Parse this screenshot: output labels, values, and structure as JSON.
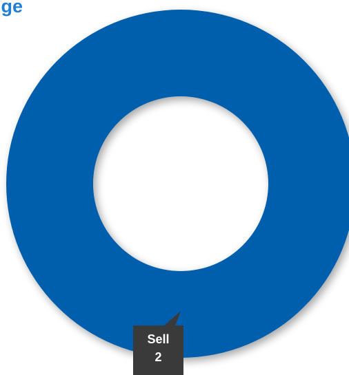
{
  "chart_data": {
    "type": "pie",
    "variant": "donut",
    "title": "ige",
    "categories": [
      "Sell"
    ],
    "values": [
      2
    ],
    "data_labels": [
      {
        "category": "Sell",
        "value": "2"
      }
    ],
    "legend": "none",
    "grid": false
  },
  "colors": {
    "title": "#1f7fd6",
    "slice": "#055ead",
    "callout_bg": "#3a3a3a",
    "callout_text": "#ffffff",
    "background": "#ffffff"
  }
}
